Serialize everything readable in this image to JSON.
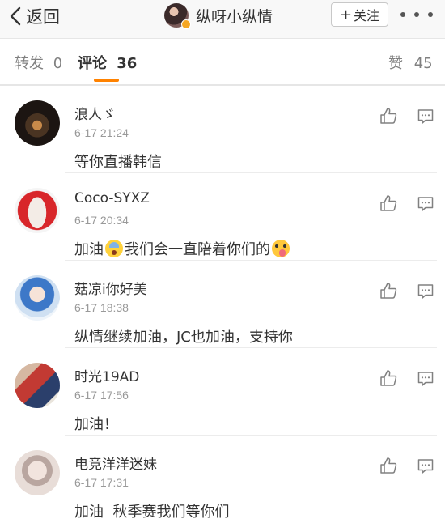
{
  "nav": {
    "back_label": "返回",
    "title": "纵呀小纵情",
    "follow_label": "关注",
    "follow_plus": "+"
  },
  "tabs": [
    {
      "label": "转发",
      "count": "0"
    },
    {
      "label": "评论",
      "count": "36"
    },
    {
      "label": "赞",
      "count": "45"
    }
  ],
  "colors": {
    "accent": "#ff8200",
    "verified_badge": "#f5a623",
    "secondary_text": "#999999"
  },
  "comments": [
    {
      "user": "浪人ゞ",
      "time": "6-17 21:24",
      "text": "等你直播韩信"
    },
    {
      "user": "Coco-SYXZ",
      "time": "6-17 20:34",
      "text_parts": [
        "加油",
        "我们会一直陪着你们的"
      ]
    },
    {
      "user": "菇凉i你好美",
      "time": "6-17 18:38",
      "text": "纵情继续加油，JC也加油，支持你"
    },
    {
      "user": "时光19AD",
      "time": "6-17 17:56",
      "text": "加油！"
    },
    {
      "user": "电竞洋洋迷妹",
      "time": "6-17 17:31",
      "text": "加油  秋季赛我们等你们"
    }
  ],
  "icons": {
    "like": "thumbs-up-icon",
    "reply": "comment-icon",
    "emoji_1": "fearful-face-emoji",
    "emoji_2": "tongue-face-emoji"
  }
}
